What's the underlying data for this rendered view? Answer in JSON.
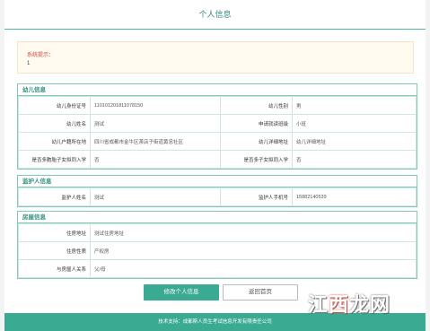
{
  "header": {
    "title": "个人信息"
  },
  "notice": {
    "title": "系统提示：",
    "value": "1"
  },
  "child": {
    "title": "幼儿信息",
    "rows": [
      {
        "l1": "幼儿身份证号",
        "v1": "110101201811078150",
        "l2": "幼儿性别",
        "v2": "男"
      },
      {
        "l1": "幼儿姓名",
        "v1": "测试",
        "l2": "申请就读班级",
        "v2": "小班"
      },
      {
        "l1": "幼儿户籍所在地",
        "v1": "四川省成都市金牛区茶店子街道黄忠社区",
        "l2": "幼儿详细地址",
        "v2": "幼儿详细地址"
      },
      {
        "l1": "是否多胞胎子女拟同入学",
        "v1": "否",
        "l2": "是否多子女拟同入学",
        "v2": "否"
      }
    ]
  },
  "guardian": {
    "title": "监护人信息",
    "rows": [
      {
        "l1": "监护人姓名",
        "v1": "测试",
        "l2": "监护人手机号",
        "v2": "15882140539"
      }
    ]
  },
  "housing": {
    "title": "房屋信息",
    "rows": [
      {
        "l": "住房地址",
        "v": "测试住房地址"
      },
      {
        "l": "住房性质",
        "v": "产权房"
      },
      {
        "l": "与房屋人关系",
        "v": "父/母"
      }
    ]
  },
  "buttons": {
    "edit": "修改个人信息",
    "back": "返回首页"
  },
  "footer": {
    "text": "技术支持：成都斯人员生考试信息开发有限责任公司"
  },
  "watermark": {
    "prefix": "江",
    "highlight": "西",
    "suffix": "龙网"
  },
  "colors": {
    "accent": "#3aaa92",
    "notice_title": "#d9463a"
  }
}
